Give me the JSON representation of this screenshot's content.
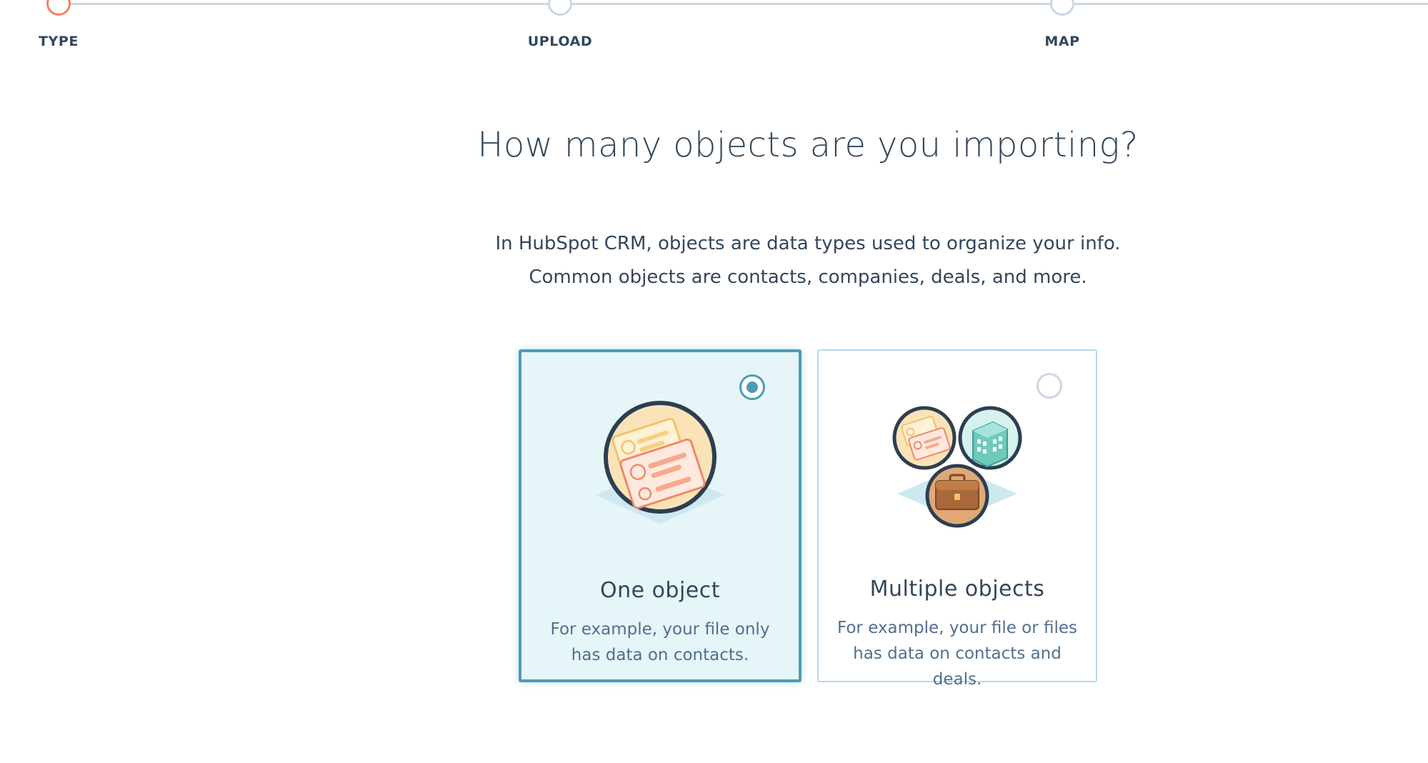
{
  "stepper": {
    "steps": [
      {
        "label": "TYPE",
        "state": "active"
      },
      {
        "label": "UPLOAD",
        "state": "upcoming"
      },
      {
        "label": "MAP",
        "state": "upcoming"
      }
    ]
  },
  "main": {
    "title": "How many objects are you importing?",
    "intro": "In HubSpot CRM, objects are data types used to organize your info. Common objects are contacts, companies, deals, and more."
  },
  "options": [
    {
      "title": "One object",
      "description": "For example, your file only has data on contacts.",
      "selected": true,
      "illustration": "contact-cards-icon"
    },
    {
      "title": "Multiple objects",
      "description": "For example, your file or files has data on contacts and deals.",
      "selected": false,
      "illustration": "contacts-companies-deals-icon"
    }
  ],
  "colors": {
    "accent": "#4a9db5",
    "active_step": "#f2825e",
    "text": "#33475b",
    "muted_text": "#516f90",
    "selected_card_bg": "#e5f5f8",
    "track": "#cbd6e2"
  }
}
